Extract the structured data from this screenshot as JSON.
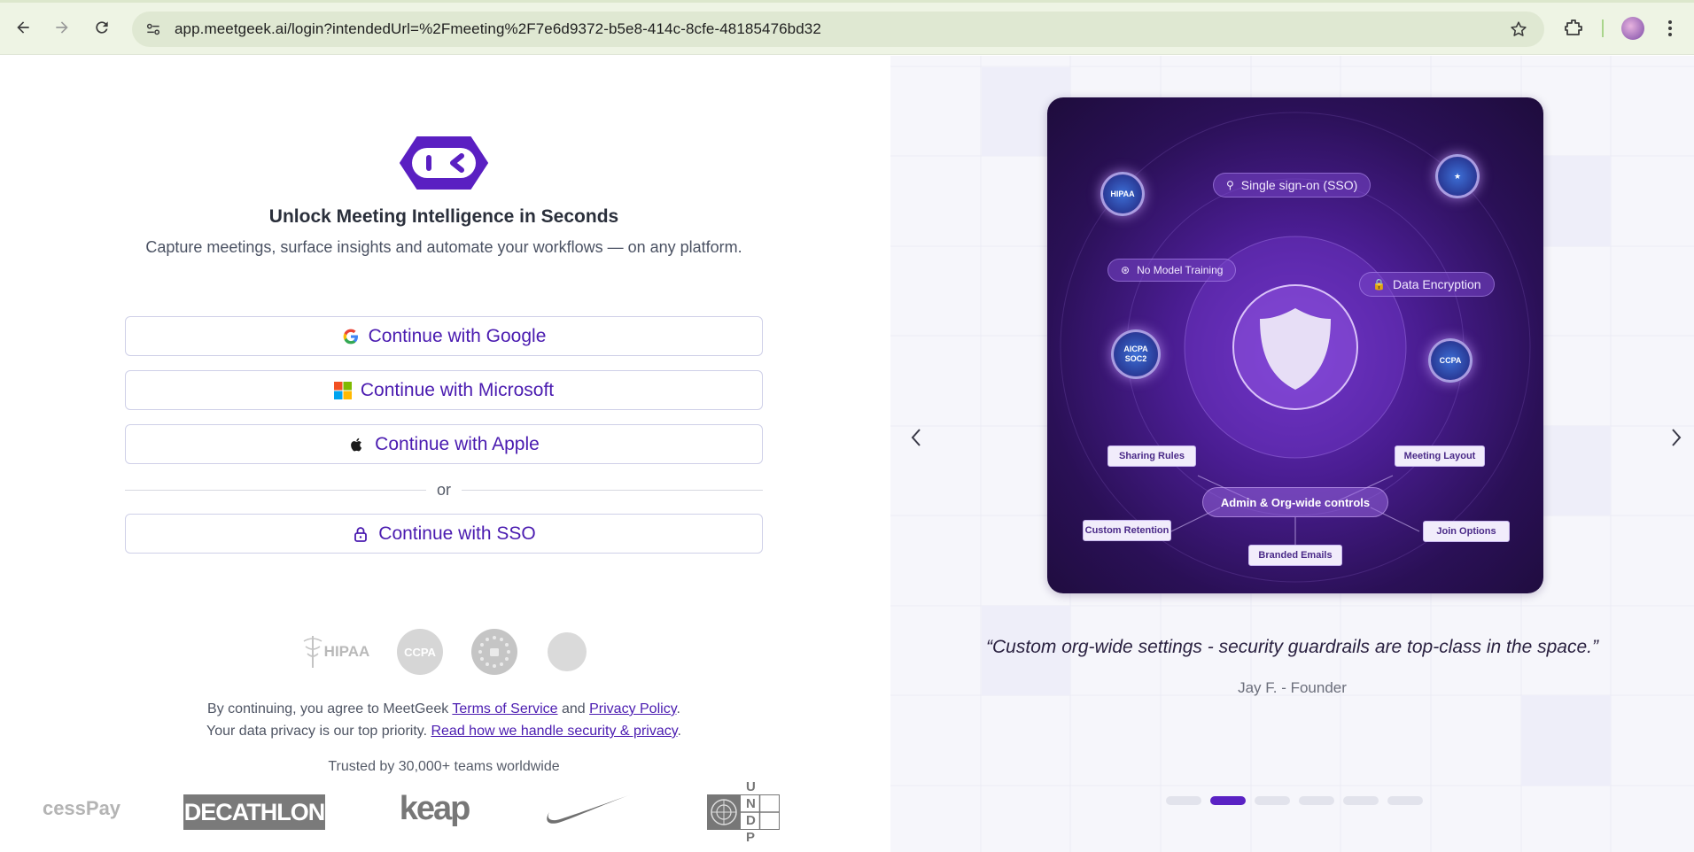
{
  "browser": {
    "url": "app.meetgeek.ai/login?intendedUrl=%2Fmeeting%2F7e6d9372-b5e8-414c-8cfe-48185476bd32",
    "icons": [
      "back-icon",
      "forward-icon",
      "reload-icon",
      "site-info-icon",
      "star-icon",
      "extensions-icon",
      "profile-avatar",
      "menu-icon"
    ]
  },
  "login": {
    "title": "Unlock Meeting Intelligence in Seconds",
    "subtitle": "Capture meetings, surface insights and automate your workflows — on any platform.",
    "google_label": "Continue with Google",
    "microsoft_label": "Continue with Microsoft",
    "apple_label": "Continue with Apple",
    "or_label": "or",
    "sso_label": "Continue with SSO",
    "badges": {
      "hipaa": "HIPAA",
      "ccpa": "CCPA"
    },
    "legal": {
      "line1_prefix": "By continuing, you agree to MeetGeek ",
      "terms": "Terms of Service",
      "and": " and ",
      "privacy": "Privacy Policy",
      "period": ".",
      "line2_prefix": "Your data privacy is our top priority. ",
      "security_link": "Read how we handle security & privacy",
      "period2": "."
    },
    "trusted": "Trusted by 30,000+ teams worldwide",
    "brands": {
      "accesspay": "cessPay",
      "decathlon": "DECATHLON",
      "keap": "keap",
      "undp": "U N D P"
    },
    "accent_color": "#4a1bb0"
  },
  "carousel": {
    "card": {
      "sso": "Single sign-on (SSO)",
      "no_training": "No Model Training",
      "encryption": "Data Encryption",
      "hipaa_seal": "HIPAA",
      "aicpa_seal": "AICPA SOC2",
      "ccpa_seal": "CCPA",
      "sharing_rules": "Sharing Rules",
      "meeting_layout": "Meeting Layout",
      "admin": "Admin & Org-wide controls",
      "custom_retention": "Custom Retention",
      "join_options": "Join Options",
      "branded_emails": "Branded Emails"
    },
    "quote": "“Custom org-wide settings - security guardrails are top-class in the space.”",
    "author": "Jay F. - Founder",
    "slide_count": 6,
    "active_slide": 2,
    "active_color": "#5a22c4"
  }
}
